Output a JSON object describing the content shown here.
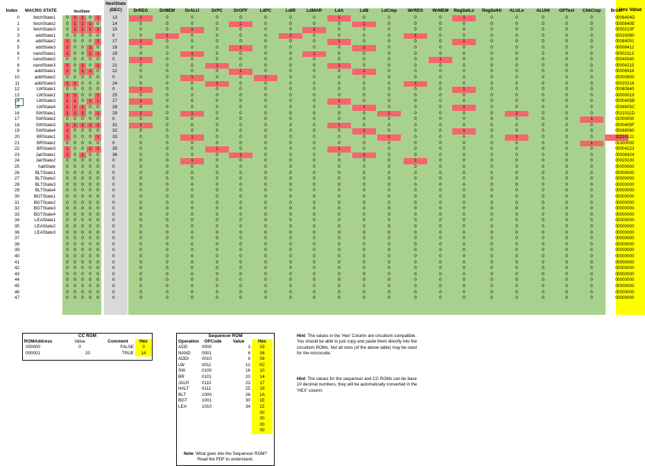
{
  "colors": {
    "green": "#a9d18e",
    "red": "#f4666b",
    "yellow": "#ffff00",
    "gray": "#d9d9d9"
  },
  "headers": {
    "index": "Index",
    "macro": "MACRO STATE",
    "next_state": "NextState",
    "next_dec_1": "NextState",
    "next_dec_2": "(DEC)",
    "hex": "Hex Value",
    "signals": [
      "DrREG",
      "DrMEM",
      "DrALU",
      "DrPC",
      "DrOFF",
      "LdPC",
      "LdIR",
      "LdMAR",
      "LdA",
      "LdB",
      "LdCmp",
      "WrREG",
      "WrMEM",
      "RegSelLo",
      "RegSelHi",
      "ALULo",
      "ALUHi",
      "OPTest",
      "ChkCmp",
      "BrSel"
    ]
  },
  "rows": [
    {
      "i": "0",
      "name": "fetchState1",
      "ns": "01101",
      "dec": "13",
      "hex": "008404D",
      "set": [
        0,
        8,
        13
      ]
    },
    {
      "i": "1",
      "name": "fetchState2",
      "ns": "01110",
      "dec": "14",
      "hex": "000840E",
      "set": [
        4,
        9
      ]
    },
    {
      "i": "2",
      "name": "fetchState3",
      "ns": "01111",
      "dec": "15",
      "hex": "000210F",
      "set": [
        2,
        7
      ]
    },
    {
      "i": "3",
      "name": "addState1",
      "ns": "00000",
      "dec": "0",
      "hex": "0020080",
      "set": [
        1,
        6,
        11
      ]
    },
    {
      "i": "4",
      "name": "addState2",
      "ns": "10001",
      "dec": "17",
      "hex": "0084051",
      "set": [
        0,
        8,
        13
      ]
    },
    {
      "i": "5",
      "name": "addState3",
      "ns": "10010",
      "dec": "18",
      "hex": "0008412",
      "set": [
        4,
        9
      ]
    },
    {
      "i": "6",
      "name": "nandState1",
      "ns": "10011",
      "dec": "19",
      "hex": "0002113",
      "set": [
        2,
        7
      ]
    },
    {
      "i": "7",
      "name": "nandState2",
      "ns": "00000",
      "dec": "0",
      "hex": "0040040",
      "set": [
        0,
        12
      ]
    },
    {
      "i": "8",
      "name": "nandState3",
      "ns": "10101",
      "dec": "21",
      "hex": "0004215",
      "set": [
        3,
        8
      ]
    },
    {
      "i": "9",
      "name": "addiState1",
      "ns": "10110",
      "dec": "22",
      "hex": "0008416",
      "set": [
        4,
        9
      ]
    },
    {
      "i": "10",
      "name": "addiState2",
      "ns": "00000",
      "dec": "0",
      "hex": "0000900",
      "set": [
        2,
        5
      ]
    },
    {
      "i": "11",
      "name": "addiState3",
      "ns": "11000",
      "dec": "24",
      "hex": "0020218",
      "set": [
        3,
        11
      ]
    },
    {
      "i": "12",
      "name": "LWState1",
      "ns": "00000",
      "dec": "0",
      "hex": "0080840",
      "set": [
        0,
        13
      ]
    },
    {
      "i": "13",
      "name": "LWState2",
      "ns": "11001",
      "dec": "25",
      "hex": "0000019",
      "set": []
    },
    {
      "i": "14",
      "name": "LWState3",
      "ns": "11011",
      "dec": "27",
      "hex": "000405B",
      "set": [
        0,
        8
      ]
    },
    {
      "i": "15",
      "name": "LWState4",
      "ns": "11100",
      "dec": "28",
      "hex": "008805C",
      "set": [
        9,
        13
      ]
    },
    {
      "i": "16",
      "name": "SWState1",
      "ns": "11101",
      "dec": "29",
      "hex": "021011D",
      "set": [
        0,
        2,
        10,
        15
      ]
    },
    {
      "i": "17",
      "name": "SWState2",
      "ns": "00000",
      "dec": "0",
      "hex": "1000000",
      "set": [
        18
      ]
    },
    {
      "i": "18",
      "name": "SWState3",
      "ns": "11111",
      "dec": "31",
      "hex": "000405F",
      "set": [
        0,
        8
      ]
    },
    {
      "i": "19",
      "name": "SWState4",
      "ns": "10000",
      "dec": "32",
      "hex": "0088060",
      "set": [
        9,
        13
      ]
    },
    {
      "i": "20",
      "name": "BRState1",
      "ns": "10001",
      "dec": "33",
      "hex": "2210121",
      "set": [
        2,
        10,
        15,
        19
      ]
    },
    {
      "i": "21",
      "name": "BRState2",
      "ns": "00000",
      "dec": "0",
      "hex": "1000000",
      "set": [
        18
      ]
    },
    {
      "i": "22",
      "name": "BRState3",
      "ns": "10011",
      "dec": "35",
      "hex": "0004223",
      "set": [
        3,
        8
      ]
    },
    {
      "i": "23",
      "name": "JalrState1",
      "ns": "10100",
      "dec": "36",
      "hex": "0008424",
      "set": [
        4,
        9
      ]
    },
    {
      "i": "24",
      "name": "JalrState2",
      "ns": "00000",
      "dec": "0",
      "hex": "0020100",
      "set": [
        2,
        11
      ]
    },
    {
      "i": "25",
      "name": "haltState",
      "ns": "00000",
      "dec": "0",
      "hex": "0000000",
      "set": []
    },
    {
      "i": "26",
      "name": "BLTState1",
      "ns": "00000",
      "dec": "0",
      "hex": "0000000",
      "set": []
    },
    {
      "i": "27",
      "name": "BLTState2",
      "ns": "00000",
      "dec": "0",
      "hex": "0000000",
      "set": []
    },
    {
      "i": "28",
      "name": "BLTState3",
      "ns": "00000",
      "dec": "0",
      "hex": "0000000",
      "set": []
    },
    {
      "i": "29",
      "name": "BLTState4",
      "ns": "00000",
      "dec": "0",
      "hex": "0000000",
      "set": []
    },
    {
      "i": "30",
      "name": "BGTState1",
      "ns": "00000",
      "dec": "0",
      "hex": "0000000",
      "set": []
    },
    {
      "i": "31",
      "name": "BGTState2",
      "ns": "00000",
      "dec": "0",
      "hex": "0000000",
      "set": []
    },
    {
      "i": "32",
      "name": "BGTState3",
      "ns": "00000",
      "dec": "0",
      "hex": "0000000",
      "set": []
    },
    {
      "i": "33",
      "name": "BGTState4",
      "ns": "00000",
      "dec": "0",
      "hex": "0000000",
      "set": []
    },
    {
      "i": "34",
      "name": "LEAState1",
      "ns": "00000",
      "dec": "0",
      "hex": "0000000",
      "set": []
    },
    {
      "i": "35",
      "name": "LEAState2",
      "ns": "00000",
      "dec": "0",
      "hex": "0000000",
      "set": []
    },
    {
      "i": "36",
      "name": "LEAState3",
      "ns": "00000",
      "dec": "0",
      "hex": "0000000",
      "set": []
    },
    {
      "i": "37",
      "name": "",
      "ns": "00000",
      "dec": "0",
      "hex": "0000000",
      "set": []
    },
    {
      "i": "38",
      "name": "",
      "ns": "00000",
      "dec": "0",
      "hex": "0000000",
      "set": []
    },
    {
      "i": "39",
      "name": "",
      "ns": "00000",
      "dec": "0",
      "hex": "0000000",
      "set": []
    },
    {
      "i": "40",
      "name": "",
      "ns": "00000",
      "dec": "0",
      "hex": "0000000",
      "set": []
    },
    {
      "i": "41",
      "name": "",
      "ns": "00000",
      "dec": "0",
      "hex": "0000000",
      "set": []
    },
    {
      "i": "42",
      "name": "",
      "ns": "00000",
      "dec": "0",
      "hex": "0000000",
      "set": []
    },
    {
      "i": "43",
      "name": "",
      "ns": "00000",
      "dec": "0",
      "hex": "0000000",
      "set": []
    },
    {
      "i": "44",
      "name": "",
      "ns": "00000",
      "dec": "0",
      "hex": "0000000",
      "set": []
    },
    {
      "i": "45",
      "name": "",
      "ns": "00000",
      "dec": "0",
      "hex": "0000000",
      "set": []
    },
    {
      "i": "46",
      "name": "",
      "ns": "00000",
      "dec": "0",
      "hex": "0000000",
      "set": []
    },
    {
      "i": "47",
      "name": "",
      "ns": "00000",
      "dec": "0",
      "hex": "0000000",
      "set": []
    }
  ],
  "cc_rom": {
    "title": "CC ROM",
    "headers": [
      "ROMAddress",
      "Value",
      "Comment",
      "Hex"
    ],
    "rows": [
      [
        "000000",
        "0",
        "FALSE",
        "0"
      ],
      [
        "000001",
        "20",
        "TRUE",
        "14"
      ]
    ]
  },
  "seq_rom": {
    "title": "Sequencer ROM",
    "headers": [
      "Operation",
      "OPCode",
      "Value",
      "Hex"
    ],
    "rows": [
      [
        "ADD",
        "0000",
        "3",
        "03"
      ],
      [
        "NAND",
        "0001",
        "6",
        "06"
      ],
      [
        "ADDI",
        "0010",
        "9",
        "09"
      ],
      [
        "LW",
        "0011",
        "12",
        "0C"
      ],
      [
        "SW",
        "0100",
        "16",
        "10"
      ],
      [
        "BR",
        "0101",
        "20",
        "14"
      ],
      [
        "JALR",
        "0110",
        "23",
        "17"
      ],
      [
        "HALT",
        "0111",
        "25",
        "19"
      ],
      [
        "BLT",
        "1000",
        "26",
        "1A"
      ],
      [
        "BGT",
        "1001",
        "30",
        "1E"
      ],
      [
        "LEA",
        "1010",
        "34",
        "22"
      ],
      [
        "",
        "",
        "",
        "00"
      ],
      [
        "",
        "",
        "",
        "00"
      ],
      [
        "",
        "",
        "",
        "00"
      ],
      [
        "",
        "",
        "",
        "00"
      ]
    ],
    "note_bold": "Note",
    "note": ": What goes into the Sequencer ROM? Read the PDF to understand."
  },
  "hints": [
    {
      "bold": "Hint",
      "text": ": The values in the 'Hex' Column are circuitsim compatible. You should be able to just copy and paste them directly into the circuitsim ROMs. Not all rows (of the above table) may be used for the microcode."
    },
    {
      "bold": "Hint",
      "text": ": The values for the sequencer and CC ROMs can be base 10 decimal numbers, they will be automatically converted in the 'HEX' column"
    }
  ]
}
